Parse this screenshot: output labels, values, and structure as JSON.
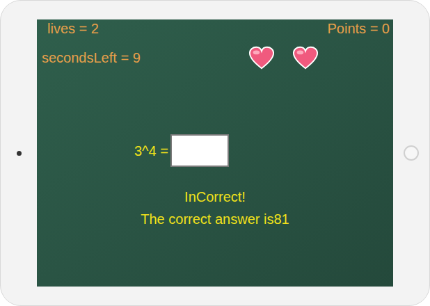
{
  "status": {
    "lives": "lives = 2",
    "points": "Points = 0",
    "seconds_left": "secondsLeft = 9"
  },
  "hearts": [
    {
      "filled": true
    },
    {
      "filled": true
    }
  ],
  "question": {
    "prompt": "3^4 =",
    "answer_field": {
      "value": ""
    }
  },
  "feedback": {
    "result": "InCorrect!",
    "correct_answer": "The correct answer is81"
  }
}
